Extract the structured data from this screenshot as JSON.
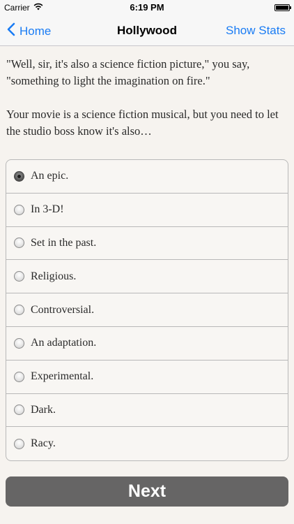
{
  "status_bar": {
    "carrier": "Carrier",
    "time": "6:19 PM"
  },
  "nav": {
    "back_label": "Home",
    "title": "Hollywood",
    "right_label": "Show Stats"
  },
  "story": {
    "paragraphs": [
      "\"Well, sir, it's also a science fiction picture,\" you say, \"something to light the imagination on fire.\"",
      "Your movie is a science fiction musical, but you need to let the studio boss know it's also…"
    ]
  },
  "choices": [
    {
      "label": "An epic.",
      "selected": true
    },
    {
      "label": "In 3-D!",
      "selected": false
    },
    {
      "label": "Set in the past.",
      "selected": false
    },
    {
      "label": "Religious.",
      "selected": false
    },
    {
      "label": "Controversial.",
      "selected": false
    },
    {
      "label": "An adaptation.",
      "selected": false
    },
    {
      "label": "Experimental.",
      "selected": false
    },
    {
      "label": "Dark.",
      "selected": false
    },
    {
      "label": "Racy.",
      "selected": false
    }
  ],
  "next_button": {
    "label": "Next"
  },
  "colors": {
    "accent": "#1a7cf4",
    "background": "#f6f3ef",
    "button": "#666565"
  }
}
